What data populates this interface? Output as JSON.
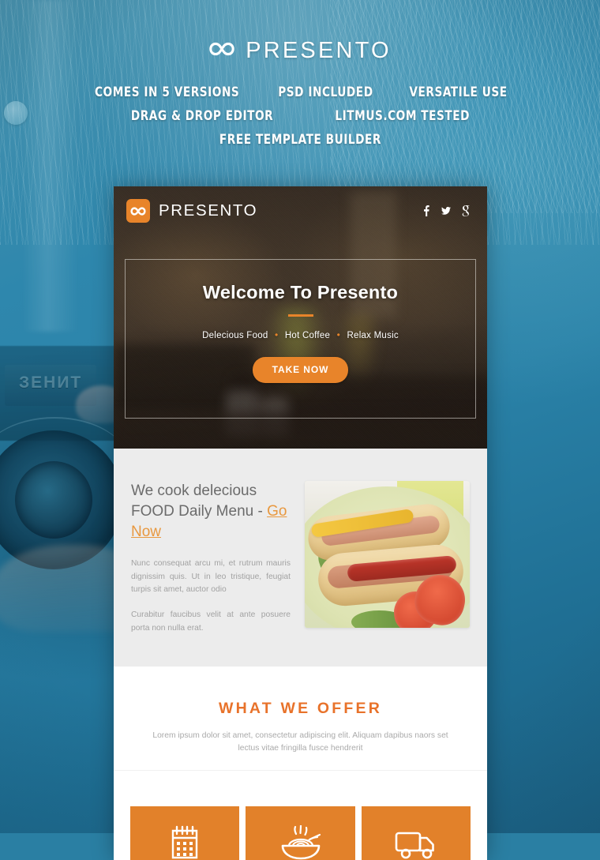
{
  "promo": {
    "brand_name": "PRESENTO",
    "brand_icon": "infinity-icon",
    "features_row1": [
      "COMES IN 5 VERSIONS",
      "PSD INCLUDED",
      "VERSATILE USE"
    ],
    "features_row2": [
      "DRAG & DROP EDITOR",
      "LITMUS.COM TESTED"
    ],
    "features_row3": [
      "FREE TEMPLATE BUILDER"
    ]
  },
  "email": {
    "header": {
      "brand_name": "PRESENTO",
      "brand_icon": "infinity-icon",
      "social": [
        {
          "name": "facebook-icon",
          "glyph": "f"
        },
        {
          "name": "twitter-icon",
          "glyph": "t"
        },
        {
          "name": "google-plus-icon",
          "glyph": "g"
        }
      ]
    },
    "hero": {
      "title": "Welcome To Presento",
      "subtitle_items": [
        "Delecious Food",
        "Hot Coffee",
        "Relax Music"
      ],
      "separator": "•",
      "cta_label": "TAKE NOW"
    },
    "intro": {
      "heading_plain": "We cook delecious FOOD Daily Menu - ",
      "heading_accent": "Go Now",
      "paragraph1": "Nunc consequat arcu mi, et rutrum mauris dignissim quis. Ut in leo tristique, feugiat turpis sit amet, auctor odio",
      "paragraph2": "Curabitur faucibus velit at ante posuere porta non nulla erat.",
      "photo_alt": "hot-dogs-plate-photo"
    },
    "offer": {
      "title": "WHAT WE OFFER",
      "subtitle": "Lorem ipsum dolor sit amet, consectetur adipiscing elit. Aliquam dapibus naors set lectus vitae fringilla fusce hendrerit"
    },
    "tiles": [
      {
        "icon": "calendar-icon"
      },
      {
        "icon": "noodle-bowl-icon"
      },
      {
        "icon": "delivery-truck-icon"
      }
    ]
  },
  "colors": {
    "brand_orange": "#e8842a",
    "tile_orange": "#e2812a",
    "offer_orange": "#e8722a",
    "accent_text": "#e8983f",
    "background_teal": "#2a82a8",
    "gray_section": "#ececec"
  }
}
